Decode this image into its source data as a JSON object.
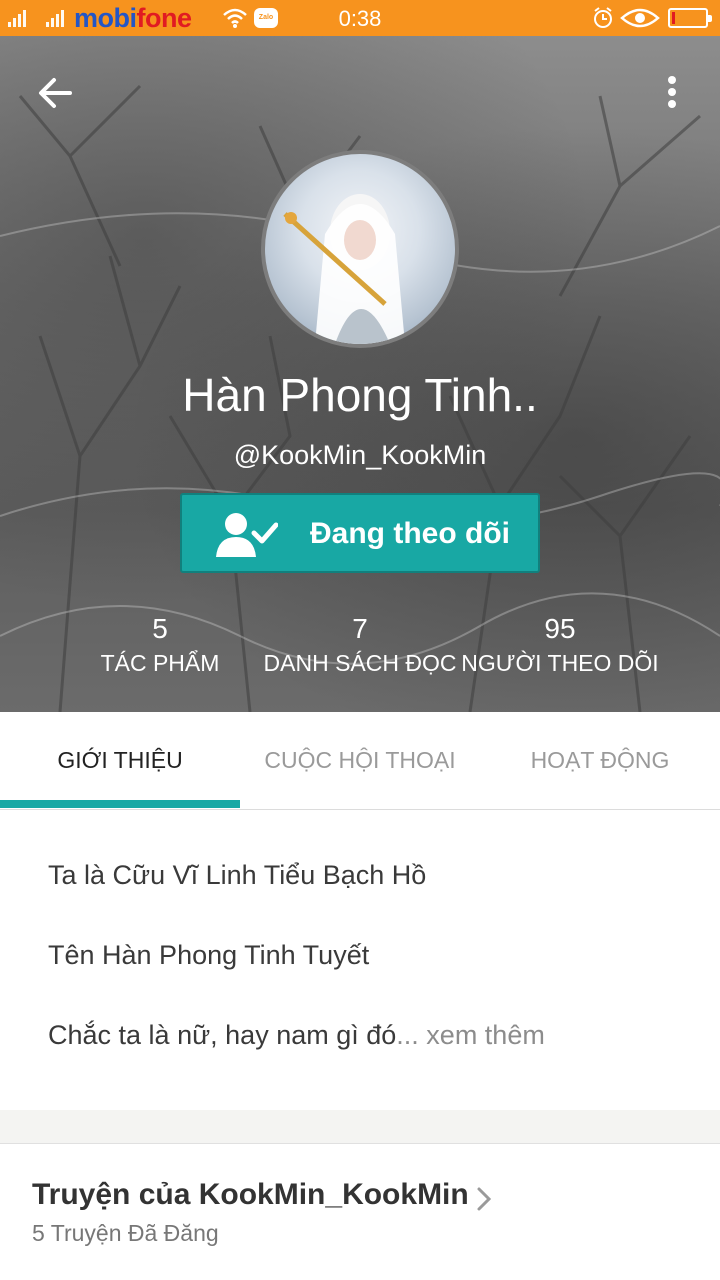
{
  "status_bar": {
    "carrier_prefix": "mobi",
    "carrier_suffix": "fone",
    "zalo_label": "Zalo",
    "time": "0:38",
    "background": "#f7931e"
  },
  "profile": {
    "display_name": "Hàn Phong Tinh..",
    "handle": "@KookMin_KookMin",
    "follow_button_label": "Đang theo dõi",
    "accent_color": "#18a8a4",
    "stats": [
      {
        "value": "5",
        "label": "TÁC PHẨM"
      },
      {
        "value": "7",
        "label": "DANH SÁCH ĐỌC"
      },
      {
        "value": "95",
        "label": "NGƯỜI THEO DÕI"
      }
    ]
  },
  "tabs": [
    {
      "label": "GIỚI THIỆU",
      "active": true
    },
    {
      "label": "CUỘC HỘI THOẠI",
      "active": false
    },
    {
      "label": "HOẠT ĐỘNG",
      "active": false
    }
  ],
  "about": {
    "lines": [
      "Ta là Cữu Vĩ Linh Tiểu Bạch Hồ",
      "Tên Hàn Phong Tinh Tuyết",
      "Chắc ta là nữ, hay nam gì đó"
    ],
    "ellipsis": "...",
    "see_more": " xem thêm"
  },
  "stories": {
    "title": "Truyện của KookMin_KookMin",
    "subtitle": "5 Truyện Đã Đăng"
  },
  "icons": [
    "signal-icon",
    "wifi-icon",
    "zalo-icon",
    "alarm-icon",
    "eye-icon",
    "battery-icon",
    "back-arrow-icon",
    "more-vert-icon",
    "person-check-icon",
    "chevron-right-icon"
  ]
}
